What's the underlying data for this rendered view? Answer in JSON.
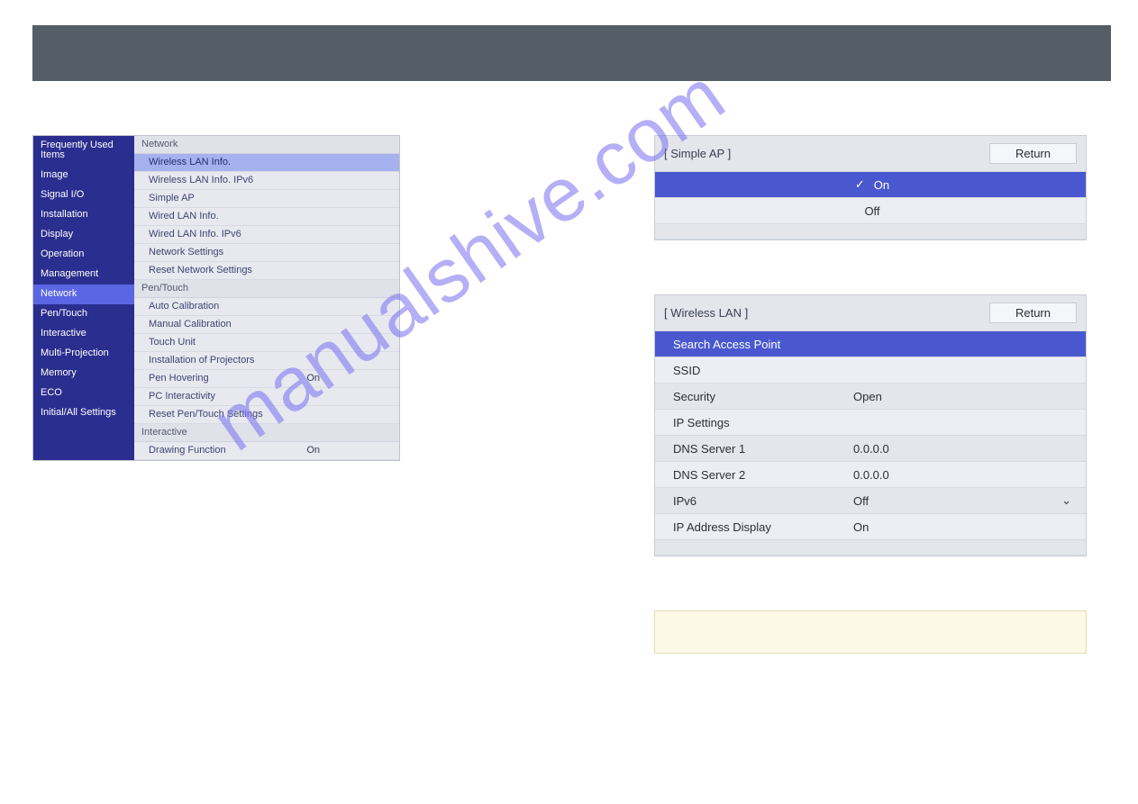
{
  "watermark": "manualshive.com",
  "menu": {
    "sidebar": [
      {
        "label": "Frequently Used Items"
      },
      {
        "label": "Image"
      },
      {
        "label": "Signal I/O"
      },
      {
        "label": "Installation"
      },
      {
        "label": "Display"
      },
      {
        "label": "Operation"
      },
      {
        "label": "Management"
      },
      {
        "label": "Network",
        "selected": true
      },
      {
        "label": "Pen/Touch"
      },
      {
        "label": "Interactive"
      },
      {
        "label": "Multi-Projection"
      },
      {
        "label": "Memory"
      },
      {
        "label": "ECO"
      },
      {
        "label": "Initial/All Settings"
      }
    ],
    "sections": [
      {
        "header": "Network",
        "rows": [
          {
            "label": "Wireless LAN Info.",
            "selected": true
          },
          {
            "label": "Wireless LAN Info. IPv6"
          },
          {
            "label": "Simple AP"
          },
          {
            "label": "Wired LAN Info."
          },
          {
            "label": "Wired LAN Info. IPv6"
          },
          {
            "label": "Network Settings"
          },
          {
            "label": "Reset Network Settings"
          }
        ]
      },
      {
        "header": "Pen/Touch",
        "rows": [
          {
            "label": "Auto Calibration"
          },
          {
            "label": "Manual Calibration"
          },
          {
            "label": "Touch Unit"
          },
          {
            "label": "Installation of Projectors"
          },
          {
            "label": "Pen Hovering",
            "value": "On"
          },
          {
            "label": "PC Interactivity"
          },
          {
            "label": "Reset Pen/Touch Settings"
          }
        ]
      },
      {
        "header": "Interactive",
        "rows": [
          {
            "label": "Drawing Function",
            "value": "On"
          }
        ]
      }
    ]
  },
  "simple_ap": {
    "title": "[ Simple AP ]",
    "return_label": "Return",
    "options": [
      {
        "label": "On",
        "selected": true
      },
      {
        "label": "Off"
      }
    ]
  },
  "wireless_lan": {
    "title": "[ Wireless LAN ]",
    "return_label": "Return",
    "rows": [
      {
        "label": "Search Access Point",
        "highlight": true
      },
      {
        "label": "SSID",
        "value": ""
      },
      {
        "label": "Security",
        "value": "Open"
      },
      {
        "label": "IP Settings",
        "value": ""
      },
      {
        "label": "DNS Server 1",
        "value": "0.0.0.0"
      },
      {
        "label": "DNS Server 2",
        "value": "0.0.0.0"
      },
      {
        "label": "IPv6",
        "value": "Off",
        "chevron": true
      },
      {
        "label": "IP Address Display",
        "value": "On"
      }
    ]
  }
}
